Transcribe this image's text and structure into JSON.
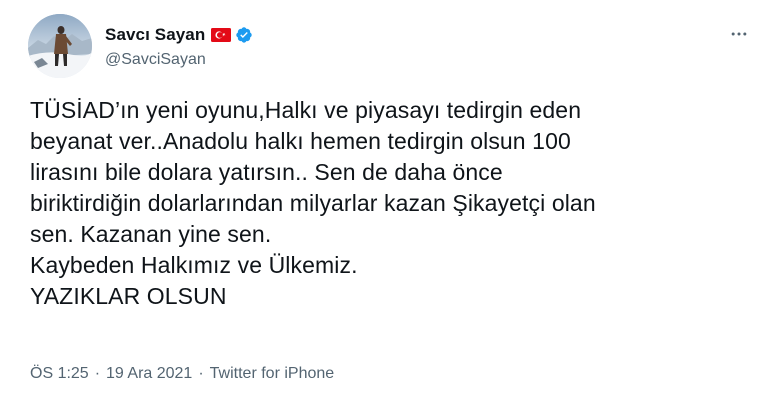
{
  "author": {
    "display_name": "Savcı Sayan",
    "handle": "@SavciSayan",
    "flag_icon": "turkey-flag-icon",
    "verified_icon": "verified-badge-icon",
    "verified_color": "#1d9bf0",
    "flag_color": "#e30a17"
  },
  "menu": {
    "icon": "more-horizontal-icon"
  },
  "tweet": {
    "lines": [
      "TÜSİAD’ın yeni oyunu,Halkı ve piyasayı tedirgin eden",
      "beyanat ver..Anadolu halkı hemen tedirgin olsun 100",
      "lirasını bile dolara yatırsın.. Sen de daha önce",
      "biriktirdiğin dolarlarından milyarlar kazan Şikayetçi olan",
      "sen. Kazanan yine sen.",
      "Kaybeden Halkımız ve Ülkemiz.",
      "YAZIKLAR OLSUN"
    ]
  },
  "meta": {
    "time": "ÖS 1:25",
    "separator": "·",
    "date": "19 Ara 2021",
    "source": "Twitter for iPhone"
  },
  "colors": {
    "text": "#0f1419",
    "secondary": "#536471",
    "background": "#ffffff"
  }
}
